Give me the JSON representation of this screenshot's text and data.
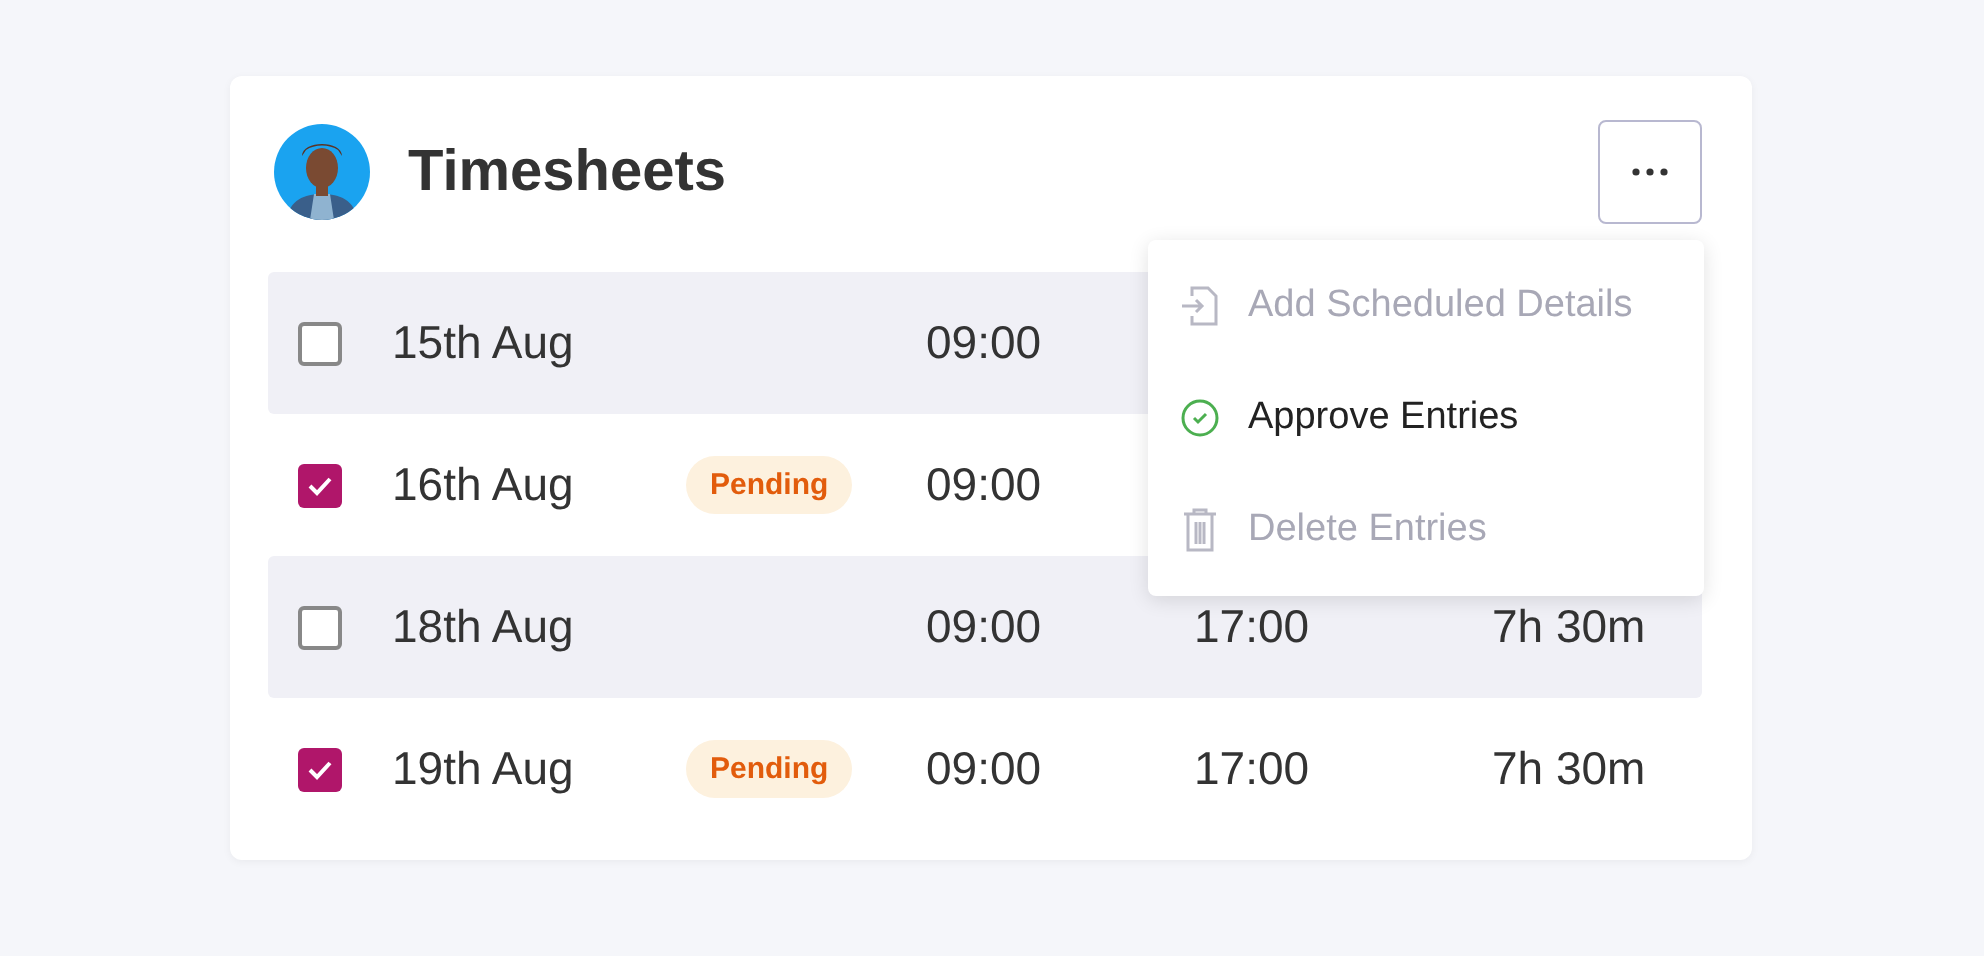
{
  "card": {
    "title": "Timesheets"
  },
  "rows": [
    {
      "date": "15th Aug",
      "checked": false,
      "status": null,
      "start": "09:00"
    },
    {
      "date": "16th Aug",
      "checked": true,
      "status": "Pending",
      "start": "09:00"
    },
    {
      "date": "18th Aug",
      "checked": false,
      "status": null,
      "start": "09:00",
      "end": "17:00",
      "duration": "7h 30m"
    },
    {
      "date": "19th Aug",
      "checked": true,
      "status": "Pending",
      "start": "09:00",
      "end": "17:00",
      "duration": "7h 30m"
    }
  ],
  "menu": {
    "items": [
      {
        "kind": "add",
        "label": "Add Scheduled Details",
        "disabled": true
      },
      {
        "kind": "approve",
        "label": "Approve Entries",
        "disabled": false
      },
      {
        "kind": "delete",
        "label": "Delete Entries",
        "disabled": true
      }
    ]
  }
}
